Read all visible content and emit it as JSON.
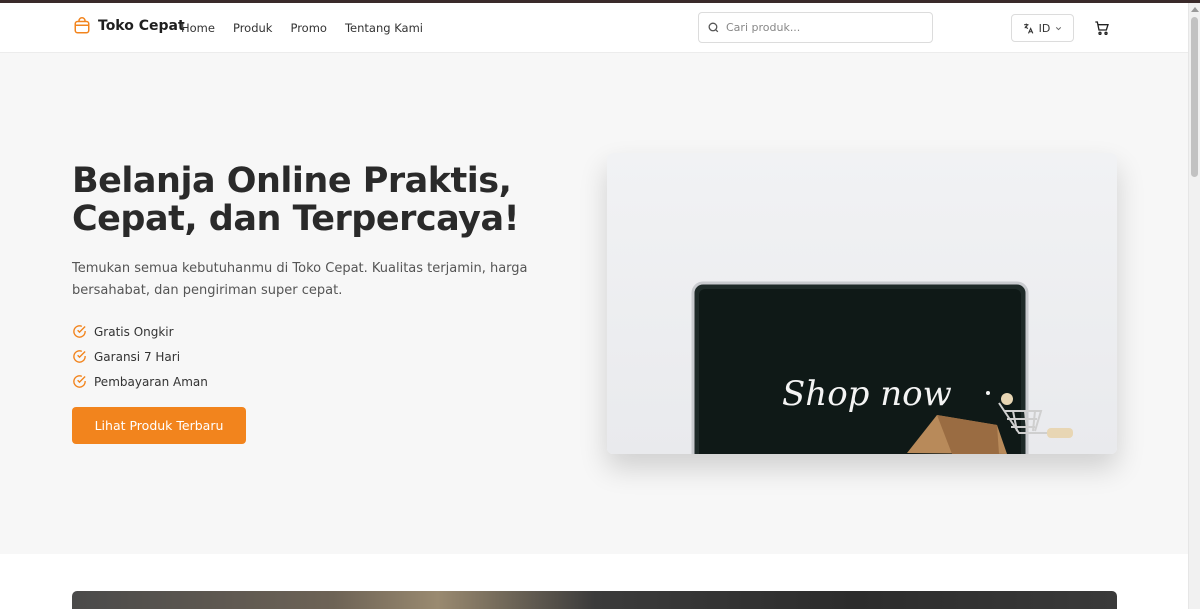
{
  "header": {
    "brand": "Toko Cepat",
    "nav": [
      "Home",
      "Produk",
      "Promo",
      "Tentang Kami"
    ],
    "search_placeholder": "Cari produk...",
    "language": "ID"
  },
  "hero": {
    "title": "Belanja Online Praktis, Cepat, dan Terpercaya!",
    "subtitle": "Temukan semua kebutuhanmu di Toko Cepat. Kualitas terjamin, harga bersahabat, dan pengiriman super cepat.",
    "features": [
      "Gratis Ongkir",
      "Garansi 7 Hari",
      "Pembayaran Aman"
    ],
    "cta": "Lihat Produk Terbaru",
    "image_text": "Shop now"
  },
  "colors": {
    "accent": "#f2841d",
    "text": "#2a2a2a",
    "hero_bg": "#f7f7f7"
  },
  "icons": {
    "logo": "shopping-bag-icon",
    "search": "search-icon",
    "language": "translate-icon",
    "chevron": "chevron-down-icon",
    "cart": "cart-icon",
    "feature": "check-circle-icon"
  }
}
